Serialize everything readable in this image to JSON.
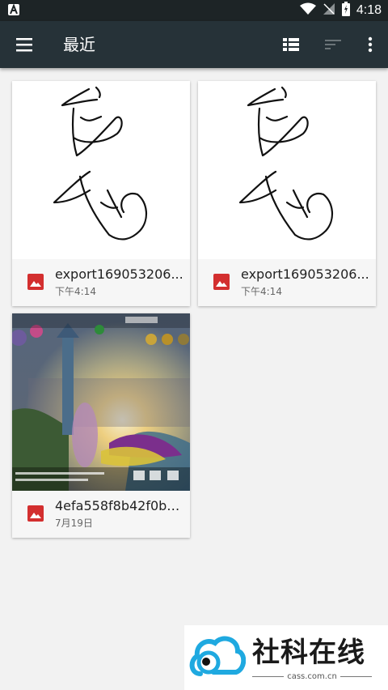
{
  "status_bar": {
    "time": "4:18"
  },
  "app_bar": {
    "title": "最近",
    "icons": [
      "menu-icon",
      "grid-view-icon",
      "sort-icon",
      "more-vert-icon"
    ]
  },
  "files": [
    {
      "name": "export169053206...",
      "date": "下午4:14",
      "type_icon": "image-file-icon"
    },
    {
      "name": "export169053206...",
      "date": "下午4:14",
      "type_icon": "image-file-icon"
    },
    {
      "name": "4efa558f8b42f0b6...",
      "date": "7月19日",
      "type_icon": "image-file-icon"
    }
  ],
  "watermark": {
    "text": "社科在线",
    "domain": "cass.com.cn"
  },
  "colors": {
    "app_bar": "#263238",
    "status_bar": "#1d2426",
    "image_icon": "#d32f2f",
    "background": "#f2f2f2"
  }
}
